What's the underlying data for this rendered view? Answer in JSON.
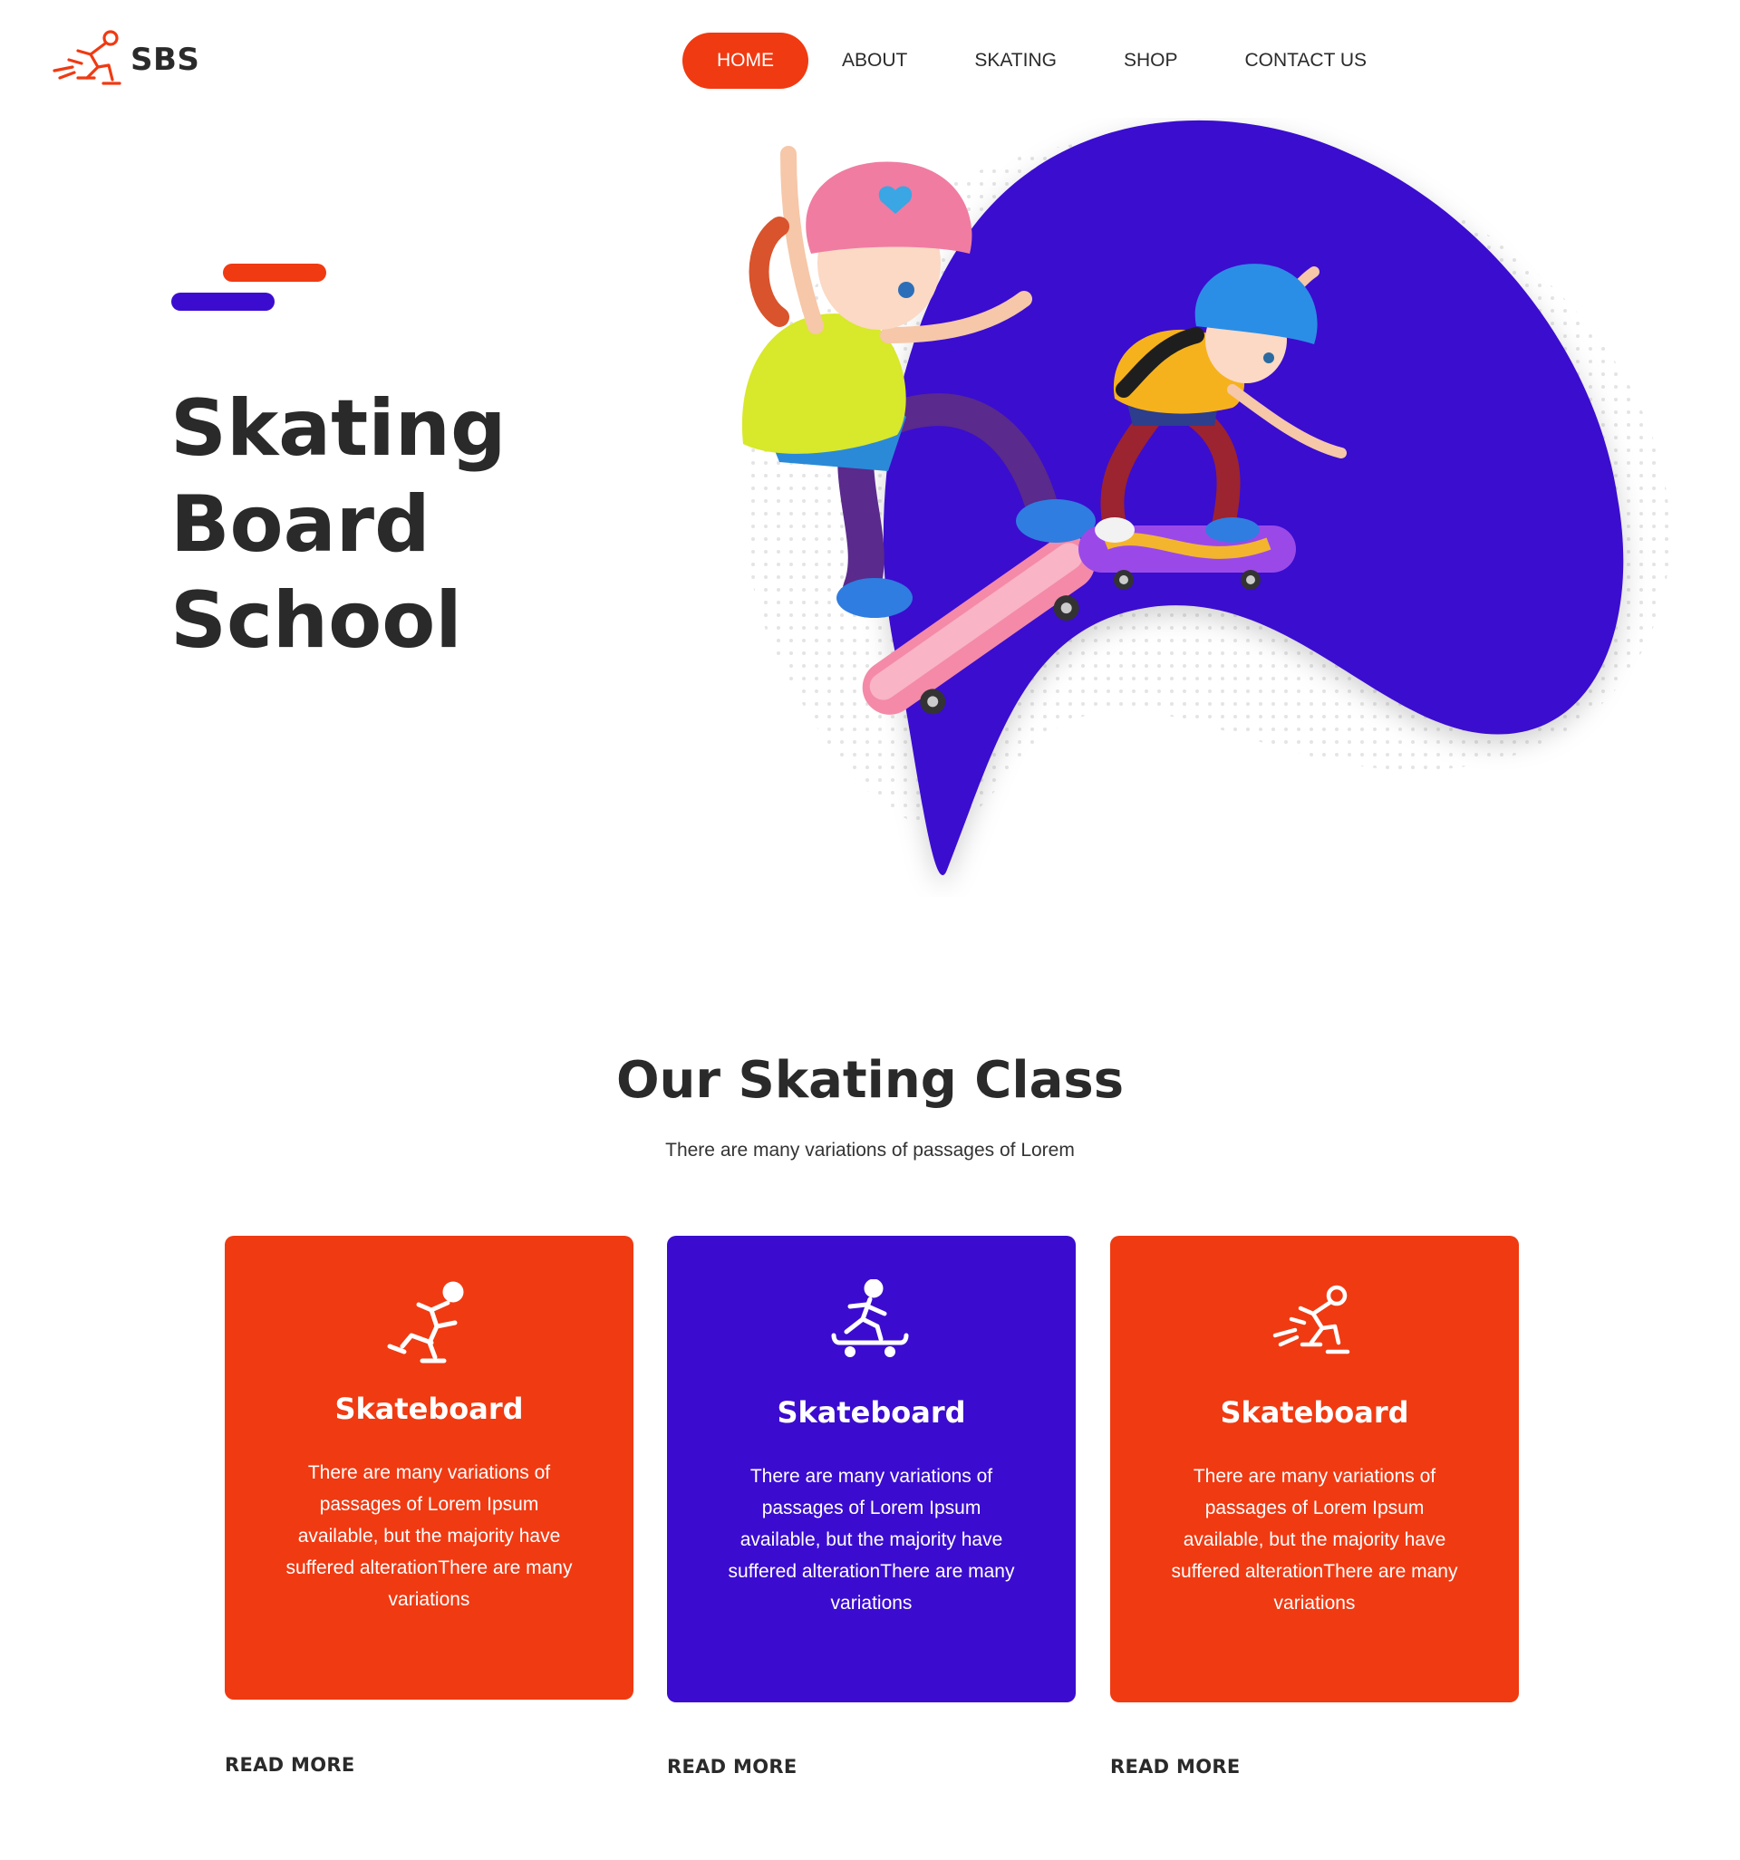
{
  "brand": {
    "name": "SBS",
    "logo_icon": "skater-icon"
  },
  "nav": {
    "items": [
      {
        "label": "HOME",
        "active": true
      },
      {
        "label": "ABOUT",
        "active": false
      },
      {
        "label": "SKATING",
        "active": false
      },
      {
        "label": "SHOP",
        "active": false
      },
      {
        "label": "CONTACT US",
        "active": false
      }
    ]
  },
  "hero": {
    "title_lines": [
      "Skating",
      "Board",
      "School"
    ]
  },
  "section": {
    "title": "Our Skating Class",
    "subtitle": "There are many variations of passages of Lorem"
  },
  "cards": [
    {
      "icon": "ice-skater-icon",
      "title": "Skateboard",
      "text": "There are many variations of passages of Lorem Ipsum available, but the majority have suffered alterationThere are many variations",
      "link": "READ MORE"
    },
    {
      "icon": "skateboarder-icon",
      "title": "Skateboard",
      "text": "There are many variations of passages of Lorem Ipsum available, but the majority have suffered alterationThere are many variations",
      "link": "READ MORE"
    },
    {
      "icon": "speed-skater-icon",
      "title": "Skateboard",
      "text": "There are many variations of passages of Lorem Ipsum available, but the majority have suffered alterationThere are many variations",
      "link": "READ MORE"
    }
  ],
  "colors": {
    "accent": "#f03a12",
    "brand_purple": "#3b0ccf",
    "text_dark": "#2a2a2a"
  }
}
